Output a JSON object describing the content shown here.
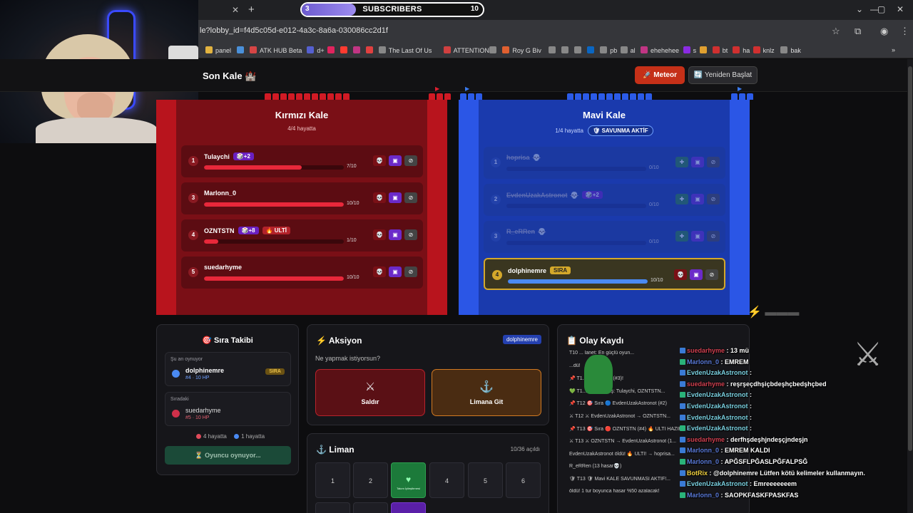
{
  "browser": {
    "url": "le?lobby_id=f4d5c05d-e012-4a3c-8a6a-030086cc2d1f",
    "subscribers": {
      "label": "SUBSCRIBERS",
      "current": "3",
      "goal": "10",
      "progress": 0.3
    },
    "bookmarks": [
      {
        "label": "panel",
        "color": "#e2b340"
      },
      {
        "label": "",
        "color": "#4a90d9"
      },
      {
        "label": "ATK HUB Beta",
        "color": "#d64545"
      },
      {
        "label": "d+",
        "color": "#5560d0"
      },
      {
        "label": "",
        "color": "#e0245e"
      },
      {
        "label": "",
        "color": "#ff3b30"
      },
      {
        "label": "",
        "color": "#c13584"
      },
      {
        "label": "",
        "color": "#e04040"
      },
      {
        "label": "The Last Of Us",
        "color": "#888"
      },
      {
        "label": "ATTENTION",
        "color": "#d04040"
      },
      {
        "label": "",
        "color": "#888"
      },
      {
        "label": "Roy G Biv",
        "color": "#e06030"
      },
      {
        "label": "",
        "color": "#888"
      },
      {
        "label": "",
        "color": "#888"
      },
      {
        "label": "",
        "color": "#888"
      },
      {
        "label": "",
        "color": "#0a66c2"
      },
      {
        "label": "pb",
        "color": "#888"
      },
      {
        "label": "al",
        "color": "#888"
      },
      {
        "label": "ehehehee",
        "color": "#c13584"
      },
      {
        "label": "s",
        "color": "#8a2be2"
      },
      {
        "label": "",
        "color": "#e0a030"
      },
      {
        "label": "bt",
        "color": "#d03030"
      },
      {
        "label": "ha",
        "color": "#d03030"
      },
      {
        "label": "knlz",
        "color": "#d03030"
      },
      {
        "label": "bak",
        "color": "#888"
      }
    ]
  },
  "app": {
    "title": "Son Kale 🏰",
    "meteor_label": "🚀 Meteor",
    "restart_label": "🔄 Yeniden Başlat"
  },
  "red_castle": {
    "title": "Kırmızı Kale",
    "subtitle": "4/4 hayatta",
    "players": [
      {
        "num": "1",
        "name": "Tulaychi",
        "tags": [
          {
            "text": "🎲+2",
            "kind": "purple"
          }
        ],
        "hp_text": "7/10",
        "hp": 0.7
      },
      {
        "num": "3",
        "name": "Marlonn_0",
        "tags": [],
        "hp_text": "10/10",
        "hp": 1.0
      },
      {
        "num": "4",
        "name": "OZNTSTN",
        "tags": [
          {
            "text": "🎲+8",
            "kind": "purple"
          },
          {
            "text": "🔥 ULTİ",
            "kind": "ulti"
          }
        ],
        "hp_text": "1/10",
        "hp": 0.1
      },
      {
        "num": "5",
        "name": "suedarhyme",
        "tags": [],
        "hp_text": "10/10",
        "hp": 1.0
      }
    ]
  },
  "blue_castle": {
    "title": "Mavi Kale",
    "subtitle": "1/4 hayatta",
    "defense_badge": "🛡 SAVUNMA AKTİF",
    "players": [
      {
        "num": "1",
        "name": "hoprisa",
        "tags": [],
        "hp_text": "0/10",
        "hp": 0,
        "dead": true
      },
      {
        "num": "2",
        "name": "EvdenUzakAstronot",
        "tags": [
          {
            "text": "🎲+2",
            "kind": "purple"
          }
        ],
        "hp_text": "0/10",
        "hp": 0,
        "dead": true
      },
      {
        "num": "3",
        "name": "R_eRRen",
        "tags": [],
        "hp_text": "0/10",
        "hp": 0,
        "dead": true
      },
      {
        "num": "4",
        "name": "dolphinemre",
        "tags": [
          {
            "text": "SIRA",
            "kind": "sira"
          }
        ],
        "hp_text": "10/10",
        "hp": 1.0,
        "dead": false,
        "turn": true
      }
    ]
  },
  "turn_panel": {
    "title": "🎯 Sıra Takibi",
    "current_label": "Şu an oynuyor",
    "current_name": "dolphinemre",
    "current_sub": "#4 · 10 HP",
    "current_tag": "SIRA",
    "next_label": "Sıradaki",
    "next_name": "suedarhyme",
    "next_sub": "#5 · 10 HP",
    "red_alive": "4 hayatta",
    "blue_alive": "1 hayatta",
    "waiting": "⏳ Oyuncu oynuyor..."
  },
  "action_panel": {
    "title": "⚡ Aksiyon",
    "user": "dolphinemre",
    "question": "Ne yapmak istiyorsun?",
    "attack_label": "Saldır",
    "port_label": "Limana Git"
  },
  "harbor_panel": {
    "title": "⚓ Liman",
    "opened": "10/36 açıldı",
    "cells": [
      "1",
      "2",
      "",
      "4",
      "5",
      "6"
    ],
    "heal_text": "Takım İyileştirmesi"
  },
  "log_panel": {
    "title": "📋 Olay Kaydı",
    "lines": [
      "T10 ... lanet: En güçlü oyun...",
      "...dü!",
      "📌 T1... Marlonn_0 (#3)!",
      "💚 T1... Toplu Diriliş: Tulaychi, OZNTSTN...",
      "📌 T12 🎯 Sıra 🔵 EvdenUzakAstronot (#2)",
      "⚔ T12 ⚔ EvdenUzakAstronot → OZNTSTN...",
      "📌 T13 🎯 Sıra 🔴 OZNTSTN (#4) 🔥 ULTİ HAZIR!",
      "⚔ T13 ⚔ OZNTSTN → EvdenUzakAstronot (1...",
      "EvdenUzakAstronot öldü! 🔥 ULTİ! → hoprisa...",
      "R_eRRen (13 hasar💀)",
      "🛡 T13 🛡 Mavi KALE SAVUNMASI AKTİF!...",
      "öldü! 1 tur boyunca hasar %50 azalacak!"
    ]
  },
  "chat": [
    {
      "user": "suedarhyme",
      "msg": "13 mü",
      "color": "#d04050"
    },
    {
      "user": "Marlonn_0",
      "msg": "EMREM",
      "color": "#5a7ad8"
    },
    {
      "user": "EvdenUzakAstronot",
      "msg": "",
      "color": "#7ad0e0"
    },
    {
      "user": "suedarhyme",
      "msg": "reşrşeçdhşiçbdeşhçbedşhçbed",
      "color": "#d04050"
    },
    {
      "user": "EvdenUzakAstronot",
      "msg": "",
      "color": "#7ad0e0"
    },
    {
      "user": "EvdenUzakAstronot",
      "msg": "",
      "color": "#7ad0e0"
    },
    {
      "user": "EvdenUzakAstronot",
      "msg": "",
      "color": "#7ad0e0"
    },
    {
      "user": "EvdenUzakAstronot",
      "msg": "",
      "color": "#7ad0e0"
    },
    {
      "user": "suedarhyme",
      "msg": "derfhşdeşhjndeşçjndeşjn",
      "color": "#d04050"
    },
    {
      "user": "Marlonn_0",
      "msg": "EMREM KALDI",
      "color": "#5a7ad8"
    },
    {
      "user": "Marlonn_0",
      "msg": "APĞSFLPĞASLPĞFALPSĞ",
      "color": "#5a7ad8"
    },
    {
      "user": "BotRix",
      "msg": "@dolphinemre Lütfen kötü kelimeler kullanmayın.",
      "color": "#f0d040"
    },
    {
      "user": "EvdenUzakAstronot",
      "msg": "Emreeeeeeem",
      "color": "#7ad0e0"
    },
    {
      "user": "Marlonn_0",
      "msg": "SAOPKFASKFPASKFAS",
      "color": "#5a7ad8"
    }
  ],
  "colors": {
    "red": "#e8283a",
    "blue": "#4a8af2",
    "gold": "#d4a82a"
  }
}
